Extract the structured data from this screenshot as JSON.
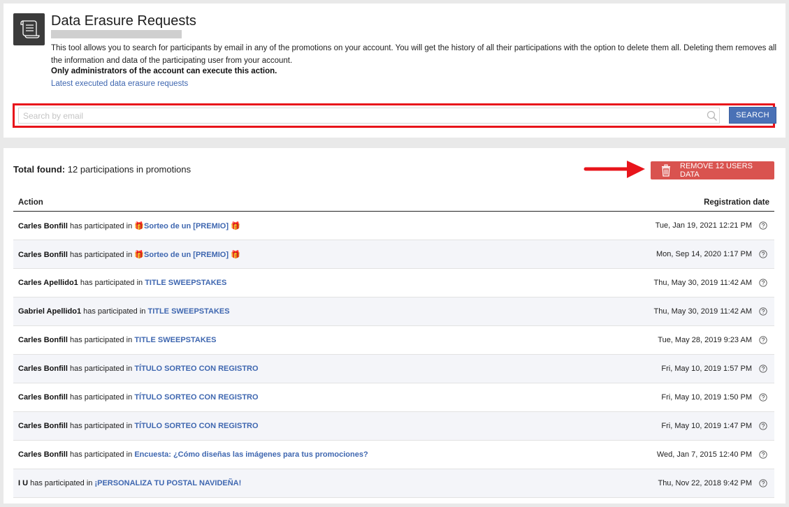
{
  "header": {
    "title": "Data Erasure Requests",
    "description": "This tool allows you to search for participants by email in any of the promotions on your account. You will get the history of all their participations with the option to delete them all. Deleting them removes all the information and data of the participating user from your account.",
    "admin_note": "Only administrators of the account can execute this action.",
    "latest_link": "Latest executed data erasure requests"
  },
  "search": {
    "placeholder": "Search by email",
    "value": "",
    "button_label": "SEARCH"
  },
  "results": {
    "total_label": "Total found:",
    "total_text": "12 participations in promotions",
    "remove_button_label": "REMOVE 12 USERS DATA",
    "columns": {
      "action": "Action",
      "date": "Registration date"
    },
    "rows": [
      {
        "name": "Carles Bonfill",
        "mid": "has participated in",
        "promo": "🎁Sorteo de un [PREMIO] 🎁",
        "date": "Tue, Jan 19, 2021 12:21 PM"
      },
      {
        "name": "Carles Bonfill",
        "mid": "has participated in",
        "promo": "🎁Sorteo de un [PREMIO] 🎁",
        "date": "Mon, Sep 14, 2020 1:17 PM"
      },
      {
        "name": "Carles Apellido1",
        "mid": "has participated in",
        "promo": "TITLE SWEEPSTAKES",
        "date": "Thu, May 30, 2019 11:42 AM"
      },
      {
        "name": "Gabriel Apellido1",
        "mid": "has participated in",
        "promo": "TITLE SWEEPSTAKES",
        "date": "Thu, May 30, 2019 11:42 AM"
      },
      {
        "name": "Carles Bonfill",
        "mid": "has participated in",
        "promo": "TITLE SWEEPSTAKES",
        "date": "Tue, May 28, 2019 9:23 AM"
      },
      {
        "name": "Carles Bonfill",
        "mid": "has participated in",
        "promo": "TÍTULO SORTEO CON REGISTRO",
        "date": "Fri, May 10, 2019 1:57 PM"
      },
      {
        "name": "Carles Bonfill",
        "mid": "has participated in",
        "promo": "TÍTULO SORTEO CON REGISTRO",
        "date": "Fri, May 10, 2019 1:50 PM"
      },
      {
        "name": "Carles Bonfill",
        "mid": "has participated in",
        "promo": "TÍTULO SORTEO CON REGISTRO",
        "date": "Fri, May 10, 2019 1:47 PM"
      },
      {
        "name": "Carles Bonfill",
        "mid": "has participated in",
        "promo": "Encuesta: ¿Cómo diseñas las imágenes para tus promociones?",
        "date": "Wed, Jan 7, 2015 12:40 PM"
      },
      {
        "name": "I U",
        "mid": "has participated in",
        "promo": "¡PERSONALIZA TU POSTAL NAVIDEÑA!",
        "date": "Thu, Nov 22, 2018 9:42 PM"
      }
    ]
  },
  "colors": {
    "accent_blue": "#4a71b6",
    "link_blue": "#3f67b0",
    "danger_red": "#d9534f",
    "highlight_red": "#e8141b"
  },
  "icons": {
    "header": "document-scroll-icon",
    "search": "magnifier-icon",
    "remove": "trash-icon",
    "help": "question-circle-icon",
    "annotation": "red-arrow-icon"
  }
}
